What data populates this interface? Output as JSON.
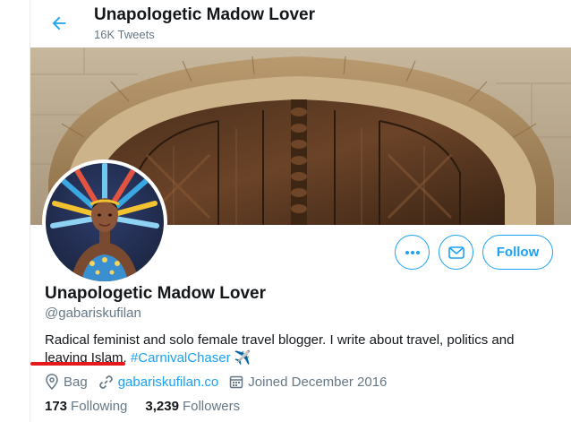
{
  "header": {
    "title": "Unapologetic Madow Lover",
    "tweet_count": "16K Tweets",
    "back_icon": "arrow-left-icon"
  },
  "profile": {
    "name": "Unapologetic Madow Lover",
    "handle": "@gabariskufilan",
    "bio_text": "Radical feminist and solo female travel blogger. I write about travel, politics and leaving Islam.",
    "bio_hashtag": "#CarnivalChaser",
    "bio_emoji": "✈️",
    "location": "Bag",
    "website": "gabariskufilan.co",
    "joined": "Joined December 2016"
  },
  "actions": {
    "more_icon": "more-icon",
    "message_icon": "envelope-icon",
    "follow_label": "Follow"
  },
  "stats": {
    "following_count": "173",
    "following_label": "Following",
    "followers_count": "3,239",
    "followers_label": "Followers"
  },
  "colors": {
    "accent": "#1da1f2",
    "text": "#14171a",
    "muted": "#657786",
    "annotation": "#e5191b"
  }
}
